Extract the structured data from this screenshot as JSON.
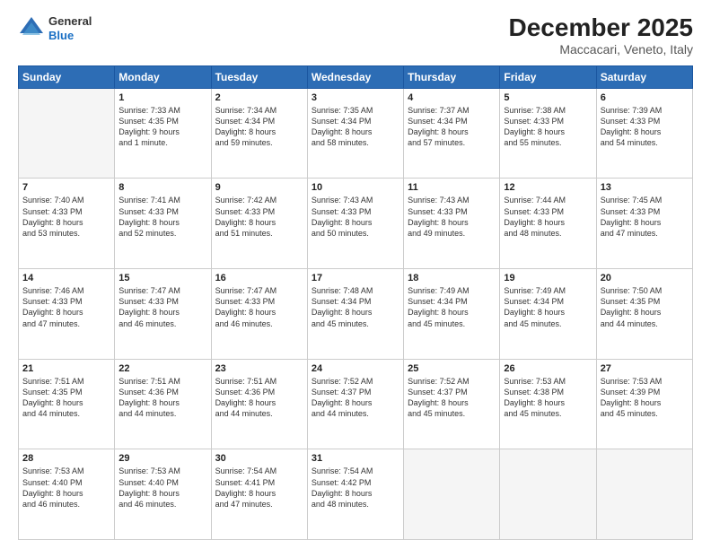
{
  "header": {
    "logo_line1": "General",
    "logo_line2": "Blue",
    "month": "December 2025",
    "location": "Maccacari, Veneto, Italy"
  },
  "weekdays": [
    "Sunday",
    "Monday",
    "Tuesday",
    "Wednesday",
    "Thursday",
    "Friday",
    "Saturday"
  ],
  "weeks": [
    [
      {
        "day": "",
        "text": ""
      },
      {
        "day": "1",
        "text": "Sunrise: 7:33 AM\nSunset: 4:35 PM\nDaylight: 9 hours\nand 1 minute."
      },
      {
        "day": "2",
        "text": "Sunrise: 7:34 AM\nSunset: 4:34 PM\nDaylight: 8 hours\nand 59 minutes."
      },
      {
        "day": "3",
        "text": "Sunrise: 7:35 AM\nSunset: 4:34 PM\nDaylight: 8 hours\nand 58 minutes."
      },
      {
        "day": "4",
        "text": "Sunrise: 7:37 AM\nSunset: 4:34 PM\nDaylight: 8 hours\nand 57 minutes."
      },
      {
        "day": "5",
        "text": "Sunrise: 7:38 AM\nSunset: 4:33 PM\nDaylight: 8 hours\nand 55 minutes."
      },
      {
        "day": "6",
        "text": "Sunrise: 7:39 AM\nSunset: 4:33 PM\nDaylight: 8 hours\nand 54 minutes."
      }
    ],
    [
      {
        "day": "7",
        "text": "Sunrise: 7:40 AM\nSunset: 4:33 PM\nDaylight: 8 hours\nand 53 minutes."
      },
      {
        "day": "8",
        "text": "Sunrise: 7:41 AM\nSunset: 4:33 PM\nDaylight: 8 hours\nand 52 minutes."
      },
      {
        "day": "9",
        "text": "Sunrise: 7:42 AM\nSunset: 4:33 PM\nDaylight: 8 hours\nand 51 minutes."
      },
      {
        "day": "10",
        "text": "Sunrise: 7:43 AM\nSunset: 4:33 PM\nDaylight: 8 hours\nand 50 minutes."
      },
      {
        "day": "11",
        "text": "Sunrise: 7:43 AM\nSunset: 4:33 PM\nDaylight: 8 hours\nand 49 minutes."
      },
      {
        "day": "12",
        "text": "Sunrise: 7:44 AM\nSunset: 4:33 PM\nDaylight: 8 hours\nand 48 minutes."
      },
      {
        "day": "13",
        "text": "Sunrise: 7:45 AM\nSunset: 4:33 PM\nDaylight: 8 hours\nand 47 minutes."
      }
    ],
    [
      {
        "day": "14",
        "text": "Sunrise: 7:46 AM\nSunset: 4:33 PM\nDaylight: 8 hours\nand 47 minutes."
      },
      {
        "day": "15",
        "text": "Sunrise: 7:47 AM\nSunset: 4:33 PM\nDaylight: 8 hours\nand 46 minutes."
      },
      {
        "day": "16",
        "text": "Sunrise: 7:47 AM\nSunset: 4:33 PM\nDaylight: 8 hours\nand 46 minutes."
      },
      {
        "day": "17",
        "text": "Sunrise: 7:48 AM\nSunset: 4:34 PM\nDaylight: 8 hours\nand 45 minutes."
      },
      {
        "day": "18",
        "text": "Sunrise: 7:49 AM\nSunset: 4:34 PM\nDaylight: 8 hours\nand 45 minutes."
      },
      {
        "day": "19",
        "text": "Sunrise: 7:49 AM\nSunset: 4:34 PM\nDaylight: 8 hours\nand 45 minutes."
      },
      {
        "day": "20",
        "text": "Sunrise: 7:50 AM\nSunset: 4:35 PM\nDaylight: 8 hours\nand 44 minutes."
      }
    ],
    [
      {
        "day": "21",
        "text": "Sunrise: 7:51 AM\nSunset: 4:35 PM\nDaylight: 8 hours\nand 44 minutes."
      },
      {
        "day": "22",
        "text": "Sunrise: 7:51 AM\nSunset: 4:36 PM\nDaylight: 8 hours\nand 44 minutes."
      },
      {
        "day": "23",
        "text": "Sunrise: 7:51 AM\nSunset: 4:36 PM\nDaylight: 8 hours\nand 44 minutes."
      },
      {
        "day": "24",
        "text": "Sunrise: 7:52 AM\nSunset: 4:37 PM\nDaylight: 8 hours\nand 44 minutes."
      },
      {
        "day": "25",
        "text": "Sunrise: 7:52 AM\nSunset: 4:37 PM\nDaylight: 8 hours\nand 45 minutes."
      },
      {
        "day": "26",
        "text": "Sunrise: 7:53 AM\nSunset: 4:38 PM\nDaylight: 8 hours\nand 45 minutes."
      },
      {
        "day": "27",
        "text": "Sunrise: 7:53 AM\nSunset: 4:39 PM\nDaylight: 8 hours\nand 45 minutes."
      }
    ],
    [
      {
        "day": "28",
        "text": "Sunrise: 7:53 AM\nSunset: 4:40 PM\nDaylight: 8 hours\nand 46 minutes."
      },
      {
        "day": "29",
        "text": "Sunrise: 7:53 AM\nSunset: 4:40 PM\nDaylight: 8 hours\nand 46 minutes."
      },
      {
        "day": "30",
        "text": "Sunrise: 7:54 AM\nSunset: 4:41 PM\nDaylight: 8 hours\nand 47 minutes."
      },
      {
        "day": "31",
        "text": "Sunrise: 7:54 AM\nSunset: 4:42 PM\nDaylight: 8 hours\nand 48 minutes."
      },
      {
        "day": "",
        "text": ""
      },
      {
        "day": "",
        "text": ""
      },
      {
        "day": "",
        "text": ""
      }
    ]
  ]
}
